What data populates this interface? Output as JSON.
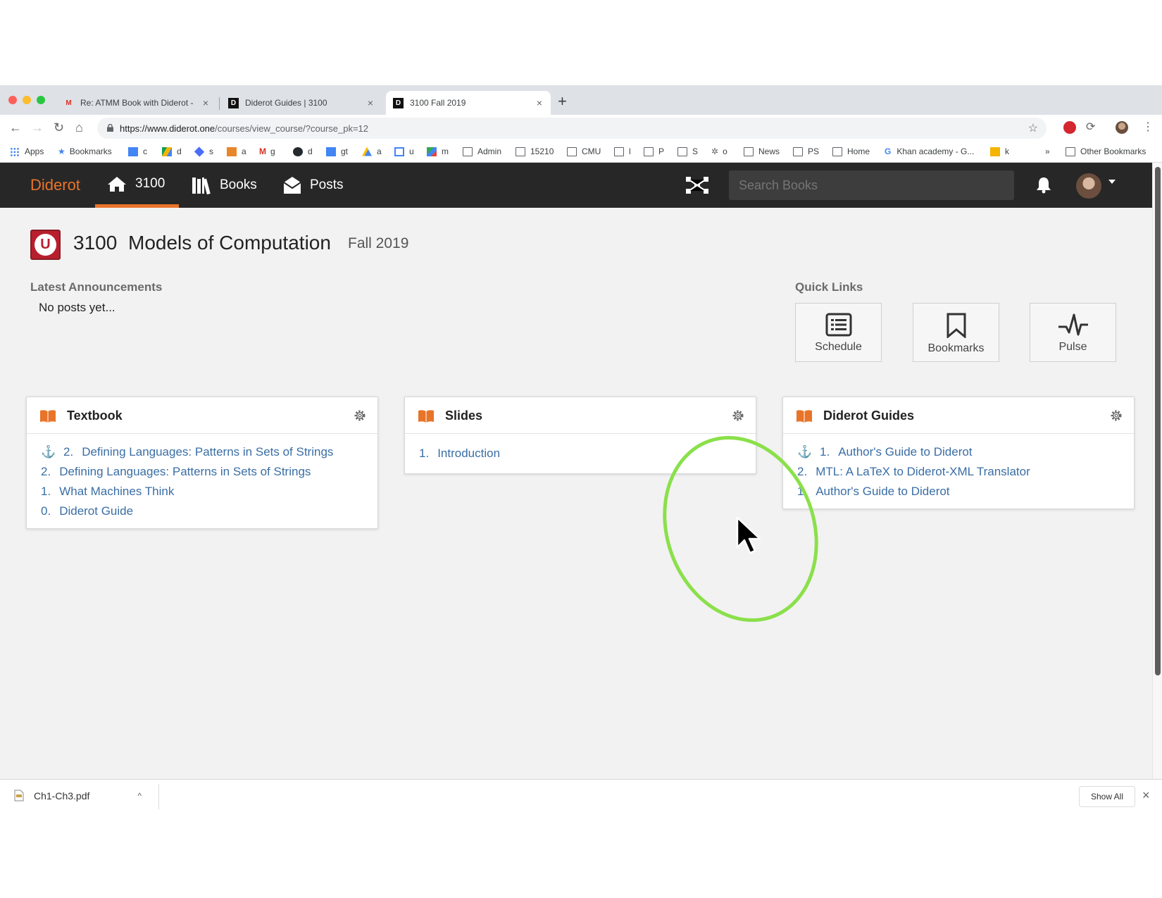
{
  "browser": {
    "tabs": [
      {
        "title": "Re: ATMM Book with Diderot -",
        "favicon": "gmail-icon"
      },
      {
        "title": "Diderot Guides | 3100",
        "favicon": "diderot-icon"
      },
      {
        "title": "3100 Fall 2019",
        "favicon": "diderot-icon",
        "active": true
      }
    ],
    "url_host": "https://www.diderot.one",
    "url_path": "/courses/view_course/?course_pk=12",
    "bookmarks": [
      "Apps",
      "Bookmarks",
      "c",
      "d",
      "s",
      "a",
      "g",
      "d",
      "gt",
      "a",
      "u",
      "m",
      "Admin",
      "15210",
      "CMU",
      "l",
      "P",
      "S",
      "o",
      "News",
      "PS",
      "Home",
      "Khan academy - G...",
      "k"
    ],
    "bookmarks_more": "»",
    "other_bookmarks": "Other Bookmarks"
  },
  "app": {
    "brand": "Diderot",
    "nav": [
      {
        "label": "3100",
        "icon": "home-icon"
      },
      {
        "label": "Books",
        "icon": "books-icon"
      },
      {
        "label": "Posts",
        "icon": "envelope-icon"
      }
    ],
    "search_placeholder": "Search Books"
  },
  "course": {
    "number": "3100",
    "name": "Models of Computation",
    "term": "Fall 2019",
    "logo_letter": "U"
  },
  "announcements": {
    "heading": "Latest Announcements",
    "empty": "No posts yet..."
  },
  "quick_links": {
    "heading": "Quick Links",
    "items": [
      {
        "label": "Schedule",
        "icon": "list-icon"
      },
      {
        "label": "Bookmarks",
        "icon": "bookmark-icon"
      },
      {
        "label": "Pulse",
        "icon": "pulse-icon"
      }
    ]
  },
  "cards": [
    {
      "title": "Textbook",
      "items": [
        {
          "anchor": true,
          "num": "2.",
          "text": "Defining Languages: Patterns in Sets of Strings"
        },
        {
          "anchor": false,
          "num": "2.",
          "text": "Defining Languages: Patterns in Sets of Strings"
        },
        {
          "anchor": false,
          "num": "1.",
          "text": "What Machines Think"
        },
        {
          "anchor": false,
          "num": "0.",
          "text": "Diderot Guide"
        }
      ]
    },
    {
      "title": "Slides",
      "items": [
        {
          "anchor": false,
          "num": "1.",
          "text": "Introduction"
        }
      ]
    },
    {
      "title": "Diderot Guides",
      "items": [
        {
          "anchor": true,
          "num": "1.",
          "text": "Author's Guide to Diderot"
        },
        {
          "anchor": false,
          "num": "2.",
          "text": "MTL: A LaTeX to Diderot-XML Translator"
        },
        {
          "anchor": false,
          "num": "1.",
          "text": "Author's Guide to Diderot"
        }
      ]
    }
  ],
  "downloads": {
    "file": "Ch1-Ch3.pdf",
    "show_all": "Show All"
  },
  "colors": {
    "accent": "#e8742a",
    "navbar": "#272727",
    "link": "#3a6ea5",
    "annotation": "#8ae04a"
  }
}
